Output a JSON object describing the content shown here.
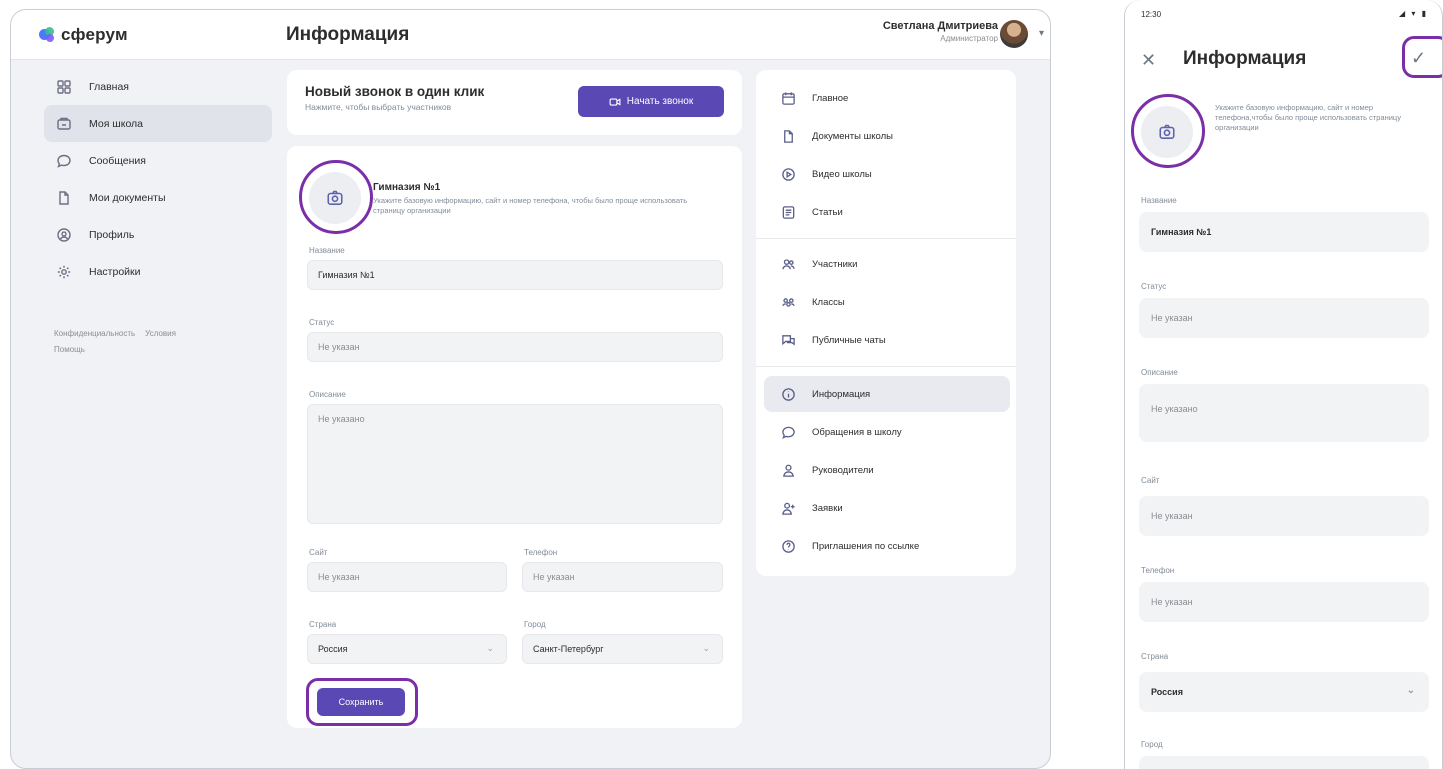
{
  "app": {
    "logo_text": "сферум"
  },
  "header": {
    "title": "Информация",
    "user_name": "Светлана Дмитриева",
    "user_role": "Администратор"
  },
  "sidebar": {
    "items": [
      {
        "label": "Главная",
        "icon": "grid-icon"
      },
      {
        "label": "Моя школа",
        "icon": "school-icon",
        "active": true
      },
      {
        "label": "Сообщения",
        "icon": "chat-icon"
      },
      {
        "label": "Мои документы",
        "icon": "document-icon"
      },
      {
        "label": "Профиль",
        "icon": "profile-icon"
      },
      {
        "label": "Настройки",
        "icon": "settings-icon"
      }
    ],
    "footer_links": [
      "Конфиденциальность",
      "Условия",
      "Помощь"
    ]
  },
  "call_card": {
    "title": "Новый звонок в один клик",
    "subtitle": "Нажмите, чтобы выбрать участников",
    "button_label": "Начать звонок"
  },
  "form": {
    "org_name": "Гимназия №1",
    "hint": "Укажите базовую информацию, сайт и номер телефона, чтобы было проще использовать страницу организации",
    "name_label": "Название",
    "name_value": "Гимназия №1",
    "status_label": "Статус",
    "status_placeholder": "Не указан",
    "description_label": "Описание",
    "description_placeholder": "Не указано",
    "site_label": "Сайт",
    "site_placeholder": "Не указан",
    "phone_label": "Телефон",
    "phone_placeholder": "Не указан",
    "country_label": "Страна",
    "country_value": "Россия",
    "city_label": "Город",
    "city_value": "Санкт-Петербург",
    "save_label": "Сохранить"
  },
  "right_menu": {
    "items": [
      {
        "label": "Главное",
        "icon": "calendar-icon"
      },
      {
        "label": "Документы школы",
        "icon": "document-icon"
      },
      {
        "label": "Видео школы",
        "icon": "play-icon"
      },
      {
        "label": "Статьи",
        "icon": "article-icon"
      },
      {
        "label": "Участники",
        "icon": "users-icon"
      },
      {
        "label": "Классы",
        "icon": "group-icon"
      },
      {
        "label": "Публичные чаты",
        "icon": "chats-icon"
      },
      {
        "label": "Информация",
        "icon": "info-icon",
        "active": true
      },
      {
        "label": "Обращения в школу",
        "icon": "chat-icon"
      },
      {
        "label": "Руководители",
        "icon": "user-icon"
      },
      {
        "label": "Заявки",
        "icon": "user-add-icon"
      },
      {
        "label": "Приглашения по ссылке",
        "icon": "link-icon"
      }
    ]
  },
  "mobile": {
    "time": "12:30",
    "title": "Информация",
    "hint": "Укажите базовую информацию, сайт и номер телефона,чтобы было проще использовать страницу организации",
    "name_label": "Название",
    "name_value": "Гимназия №1",
    "status_label": "Статус",
    "status_placeholder": "Не указан",
    "description_label": "Описание",
    "description_placeholder": "Не указано",
    "site_label": "Сайт",
    "site_placeholder": "Не указан",
    "phone_label": "Телефон",
    "phone_placeholder": "Не указан",
    "country_label": "Страна",
    "country_value": "Россия",
    "city_label": "Город"
  },
  "colors": {
    "accent": "#5a48b5",
    "highlight_ring": "#7a2ea8",
    "background": "#f0f2f5"
  }
}
